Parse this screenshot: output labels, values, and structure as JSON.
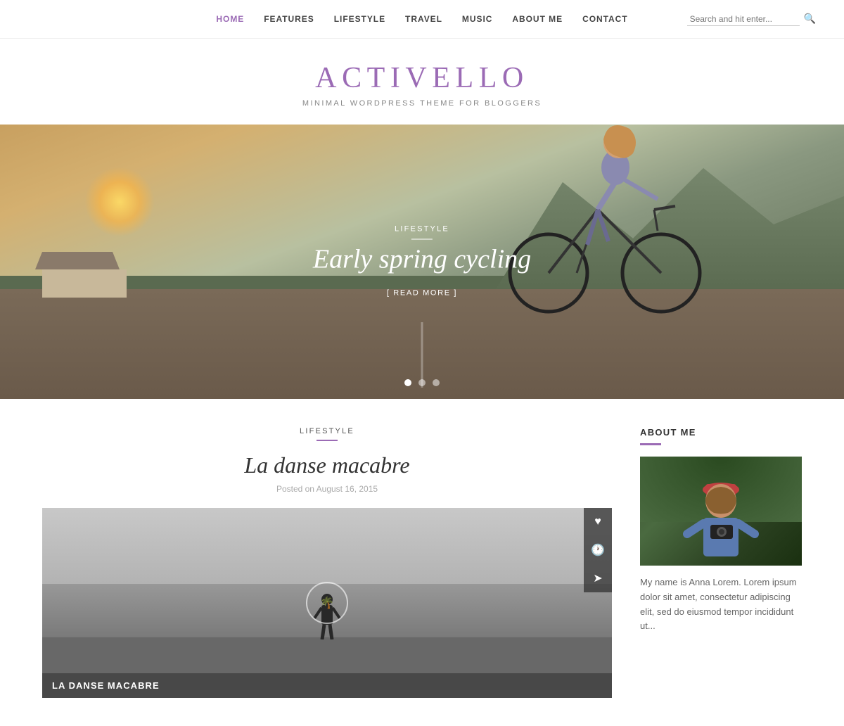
{
  "nav": {
    "links": [
      {
        "label": "HOME",
        "active": true
      },
      {
        "label": "FEATURES",
        "active": false
      },
      {
        "label": "LIFESTYLE",
        "active": false
      },
      {
        "label": "TRAVEL",
        "active": false
      },
      {
        "label": "MUSIC",
        "active": false
      },
      {
        "label": "ABOUT ME",
        "active": false
      },
      {
        "label": "CONTACT",
        "active": false
      }
    ],
    "search_placeholder": "Search and hit enter..."
  },
  "site": {
    "title": "ACTIVELLO",
    "subtitle": "MINIMAL WORDPRESS THEME FOR BLOGGERS"
  },
  "hero": {
    "category": "LIFESTYLE",
    "title": "Early spring cycling",
    "readmore": "[ READ MORE ]",
    "dots": [
      {
        "active": true
      },
      {
        "active": false
      },
      {
        "active": false
      }
    ]
  },
  "post": {
    "category": "LIFESTYLE",
    "title": "La danse macabre",
    "date": "Posted on August 16, 2015",
    "image_alt": "post thumbnail"
  },
  "sidebar": {
    "about_title": "ABOUT ME",
    "about_text": "My name is Anna Lorem. Lorem ipsum dolor sit amet, consectetur adipiscing elit, sed do eiusmod tempor incididunt ut..."
  },
  "icons": {
    "heart": "♥",
    "clock": "🕐",
    "paper_plane": "✈",
    "search": "🔍",
    "palm": "🌴"
  }
}
